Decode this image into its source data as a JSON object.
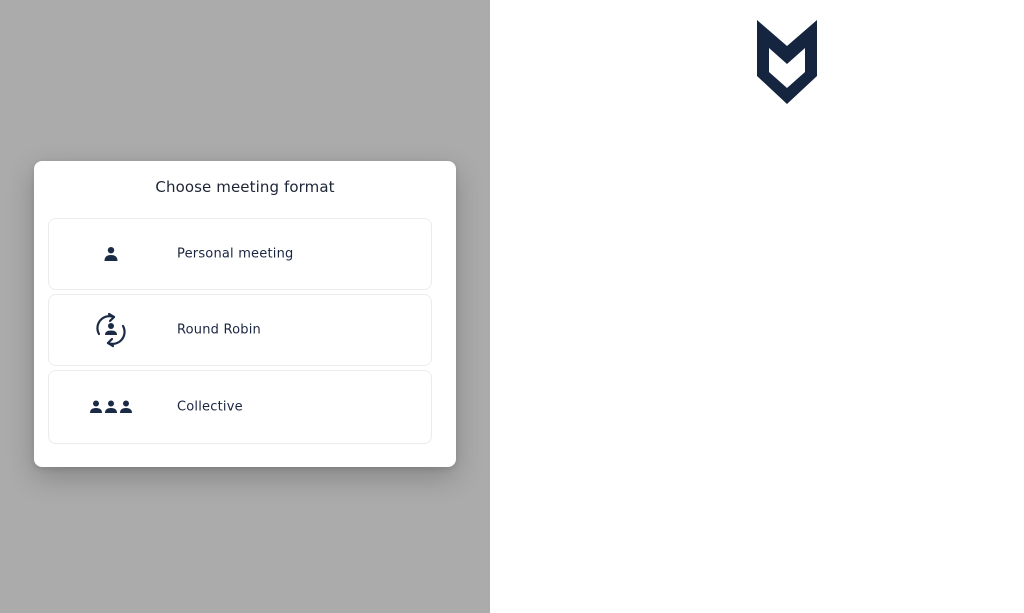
{
  "modal": {
    "title": "Choose meeting format",
    "options": [
      {
        "label": "Personal meeting",
        "icon": "person-icon"
      },
      {
        "label": "Round Robin",
        "icon": "round-robin-icon"
      },
      {
        "label": "Collective",
        "icon": "group-icon"
      }
    ]
  },
  "brand": {
    "logo_icon": "brand-logo-icon"
  },
  "colors": {
    "overlay": "#ababab",
    "icon": "#1b2b45",
    "text": "#1a2540",
    "logo": "#15253f"
  }
}
